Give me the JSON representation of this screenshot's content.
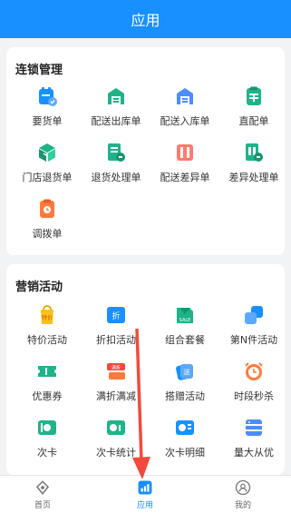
{
  "header": {
    "title": "应用"
  },
  "sections": [
    {
      "title": "连锁管理",
      "items": [
        {
          "label": "要货单",
          "icon": "order-request-icon"
        },
        {
          "label": "配送出库单",
          "icon": "delivery-out-icon"
        },
        {
          "label": "配送入库单",
          "icon": "delivery-in-icon"
        },
        {
          "label": "直配单",
          "icon": "direct-delivery-icon"
        },
        {
          "label": "门店退货单",
          "icon": "store-return-icon"
        },
        {
          "label": "退货处理单",
          "icon": "return-process-icon"
        },
        {
          "label": "配送差异单",
          "icon": "delivery-diff-icon"
        },
        {
          "label": "差异处理单",
          "icon": "diff-process-icon"
        },
        {
          "label": "调拨单",
          "icon": "transfer-icon"
        }
      ]
    },
    {
      "title": "营销活动",
      "items": [
        {
          "label": "特价活动",
          "icon": "special-price-icon",
          "badge": "特价"
        },
        {
          "label": "折扣活动",
          "icon": "discount-icon",
          "badge": "折"
        },
        {
          "label": "组合套餐",
          "icon": "combo-icon",
          "badge": "SALE"
        },
        {
          "label": "第N件活动",
          "icon": "nth-item-icon"
        },
        {
          "label": "优惠券",
          "icon": "coupon-icon"
        },
        {
          "label": "满折满减",
          "icon": "full-reduction-icon",
          "badge": "满折"
        },
        {
          "label": "搭赠活动",
          "icon": "gift-icon",
          "badge": "送"
        },
        {
          "label": "时段秒杀",
          "icon": "flash-sale-icon"
        },
        {
          "label": "次卡",
          "icon": "times-card-icon"
        },
        {
          "label": "次卡统计",
          "icon": "card-stats-icon"
        },
        {
          "label": "次卡明细",
          "icon": "card-detail-icon"
        },
        {
          "label": "量大从优",
          "icon": "bulk-discount-icon"
        }
      ]
    }
  ],
  "tabbar": {
    "items": [
      {
        "label": "首页",
        "icon": "home-icon",
        "active": false
      },
      {
        "label": "应用",
        "icon": "apps-icon",
        "active": true
      },
      {
        "label": "我的",
        "icon": "profile-icon",
        "active": false
      }
    ]
  },
  "colors": {
    "primary": "#1890ff",
    "green": "#1fb38a",
    "orange": "#ff7a3d",
    "red": "#f24a3c",
    "yellow": "#ffc21a"
  }
}
